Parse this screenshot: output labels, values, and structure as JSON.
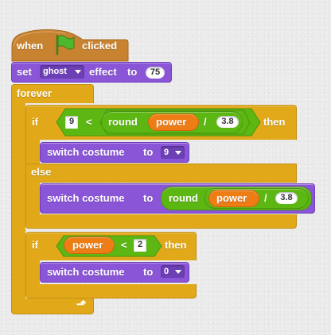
{
  "hat": {
    "prefix": "when",
    "suffix": "clicked",
    "icon": "green-flag-icon"
  },
  "set_effect": {
    "set_label": "set",
    "effect_name": "ghost",
    "effect_label": "effect",
    "to_label": "to",
    "value": "75"
  },
  "forever": {
    "label": "forever"
  },
  "if_else": {
    "if_label": "if",
    "else_label": "else",
    "then_label": "then",
    "condition": {
      "left": "9",
      "operator": "<",
      "round_label": "round",
      "variable": "power",
      "divide_operator": "/",
      "divisor": "3.8"
    }
  },
  "switch1": {
    "label": "switch costume",
    "to_label": "to",
    "value": "9"
  },
  "switch2": {
    "label": "switch costume",
    "to_label": "to",
    "round_label": "round",
    "variable": "power",
    "divide_operator": "/",
    "divisor": "3.8"
  },
  "if2": {
    "if_label": "if",
    "then_label": "then",
    "condition": {
      "variable": "power",
      "operator": "<",
      "right": "2"
    }
  },
  "switch3": {
    "label": "switch costume",
    "to_label": "to",
    "value": "0"
  },
  "colors": {
    "events": "#c88330",
    "looks": "#8a55d7",
    "control": "#e1a91a",
    "operators": "#5cb712",
    "variables": "#ee7d16"
  }
}
